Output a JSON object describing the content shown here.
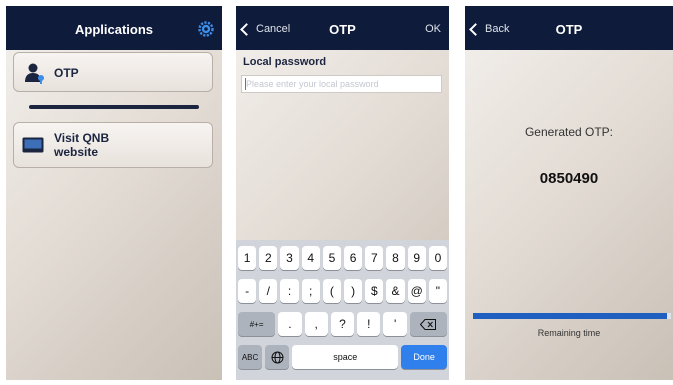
{
  "applications_screen": {
    "title": "Applications",
    "items": [
      {
        "label": "OTP",
        "icon": "user-key-icon"
      },
      {
        "label_line1": "Visit QNB",
        "label_line2": "website",
        "icon": "monitor-icon"
      }
    ]
  },
  "password_screen": {
    "cancel_label": "Cancel",
    "title": "OTP",
    "ok_label": "OK",
    "field_label": "Local password",
    "input_placeholder": "Please enter your local password",
    "input_value": "",
    "keyboard": {
      "row1": [
        "1",
        "2",
        "3",
        "4",
        "5",
        "6",
        "7",
        "8",
        "9",
        "0"
      ],
      "row2": [
        "-",
        "/",
        ":",
        ";",
        "(",
        ")",
        "$",
        "&",
        "@",
        "\""
      ],
      "row3_left": "#+=",
      "row3_mid": [
        ".",
        ",",
        "?",
        "!",
        "'"
      ],
      "row4_abc": "ABC",
      "space": "space",
      "done": "Done"
    }
  },
  "otp_screen": {
    "back_label": "Back",
    "title": "OTP",
    "generated_label": "Generated OTP:",
    "code": "0850490",
    "remaining_label": "Remaining time",
    "remaining_fraction": 0.98
  },
  "colors": {
    "navbar": "#0e1b3b",
    "accent": "#2f80ed",
    "progress": "#1f5fbf"
  }
}
